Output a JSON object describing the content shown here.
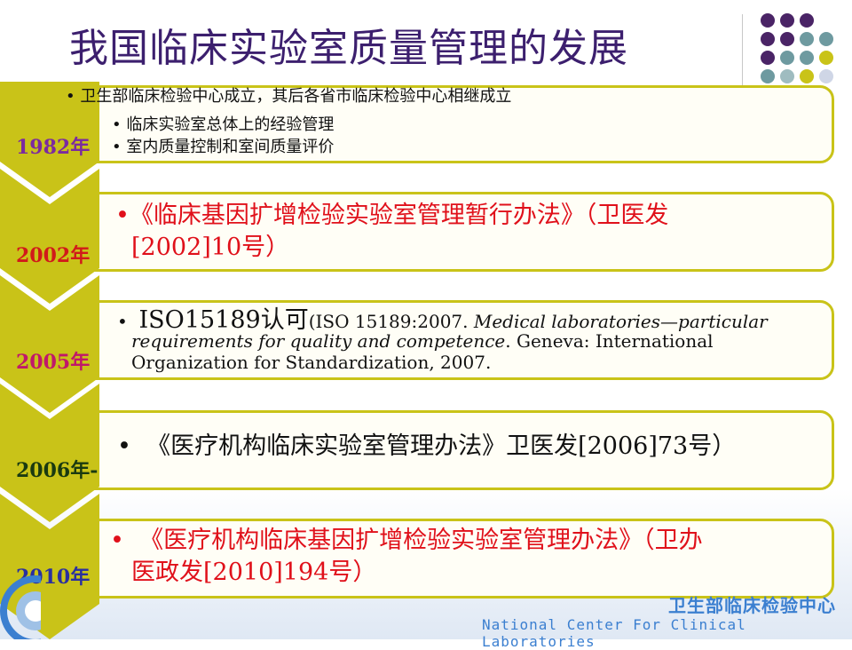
{
  "title": "我国临床实验室质量管理的发展",
  "colors": {
    "accent_olive": "#c9c318",
    "title_purple": "#3c1f6e",
    "red_text": "#e0101a"
  },
  "timeline": [
    {
      "year": "1982年",
      "year_color": "#7b2aa0",
      "items": [
        "卫生部临床检验中心成立，其后各省市临床检验中心相继成立",
        "临床实验室总体上的经验管理",
        "室内质量控制和室间质量评价"
      ]
    },
    {
      "year": "2002年",
      "year_color": "#d11a1a",
      "items": [
        "《临床基因扩增检验实验室管理暂行办法》（卫医发",
        "[2002]10号）"
      ]
    },
    {
      "year": "2005年",
      "year_color": "#c0186a",
      "items": [
        "ISO15189认可",
        "(ISO 15189:2007. ",
        "Medical laboratories—particular",
        "requirements for quality and competence",
        ". Geneva: International",
        "Organization for Standardization, 2007."
      ]
    },
    {
      "year": "2006年-",
      "year_color": "#1a3a10",
      "items": [
        "《医疗机构临床实验室管理办法》卫医发[2006]73号）"
      ]
    },
    {
      "year": "2010年",
      "year_color": "#2a2fa0",
      "items": [
        "《医疗机构临床基因扩增检验实验室管理办法》（卫办",
        "医政发[2010]194号）"
      ]
    }
  ],
  "footer": {
    "cn": "卫生部临床检验中心",
    "en": "National Center For Clinical Laboratories"
  }
}
